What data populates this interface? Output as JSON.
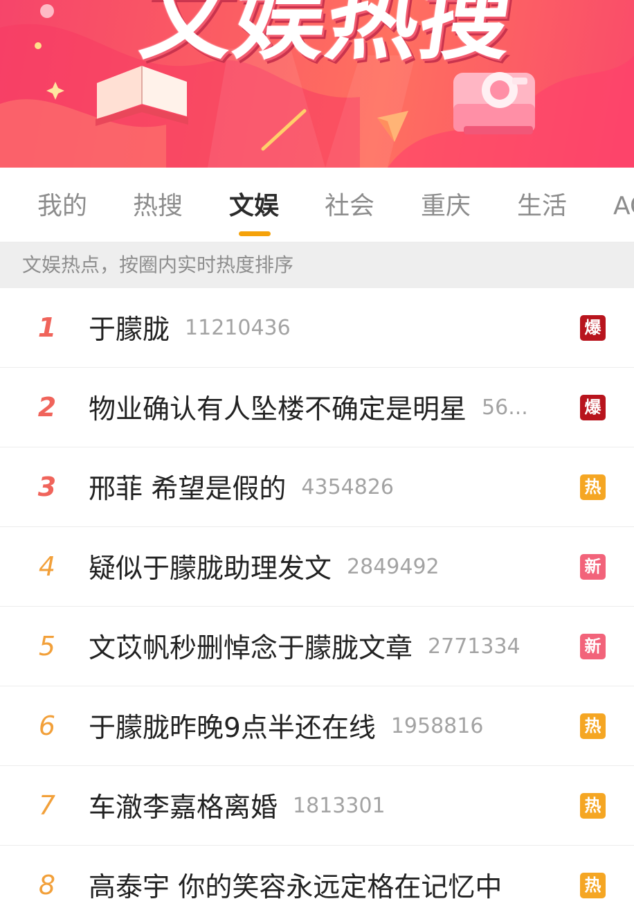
{
  "banner": {
    "title": "文娱热搜",
    "colors": {
      "bg_start": "#f6456a",
      "bg_end": "#ff7060"
    }
  },
  "tabs": [
    {
      "label": "我的",
      "active": false
    },
    {
      "label": "热搜",
      "active": false
    },
    {
      "label": "文娱",
      "active": true
    },
    {
      "label": "社会",
      "active": false
    },
    {
      "label": "重庆",
      "active": false
    },
    {
      "label": "生活",
      "active": false
    },
    {
      "label": "AC",
      "active": false
    }
  ],
  "tab_accent_color": "#f5a20a",
  "subtitle": "文娱热点，按圈内实时热度排序",
  "badge_colors": {
    "爆": "#b8141d",
    "热": "#f5a623",
    "新": "#f2637a"
  },
  "list": [
    {
      "rank": "1",
      "title": "于朦胧",
      "count": "11210436",
      "badge": "爆"
    },
    {
      "rank": "2",
      "title": "物业确认有人坠楼不确定是明星",
      "count": "56...",
      "badge": "爆"
    },
    {
      "rank": "3",
      "title": "邢菲 希望是假的",
      "count": "4354826",
      "badge": "热"
    },
    {
      "rank": "4",
      "title": "疑似于朦胧助理发文",
      "count": "2849492",
      "badge": "新"
    },
    {
      "rank": "5",
      "title": "文苡帆秒删悼念于朦胧文章",
      "count": "2771334",
      "badge": "新"
    },
    {
      "rank": "6",
      "title": "于朦胧昨晚9点半还在线",
      "count": "1958816",
      "badge": "热"
    },
    {
      "rank": "7",
      "title": "车澈李嘉格离婚",
      "count": "1813301",
      "badge": "热"
    },
    {
      "rank": "8",
      "title": "高泰宇 你的笑容永远定格在记忆中",
      "count": "",
      "badge": "热"
    }
  ]
}
